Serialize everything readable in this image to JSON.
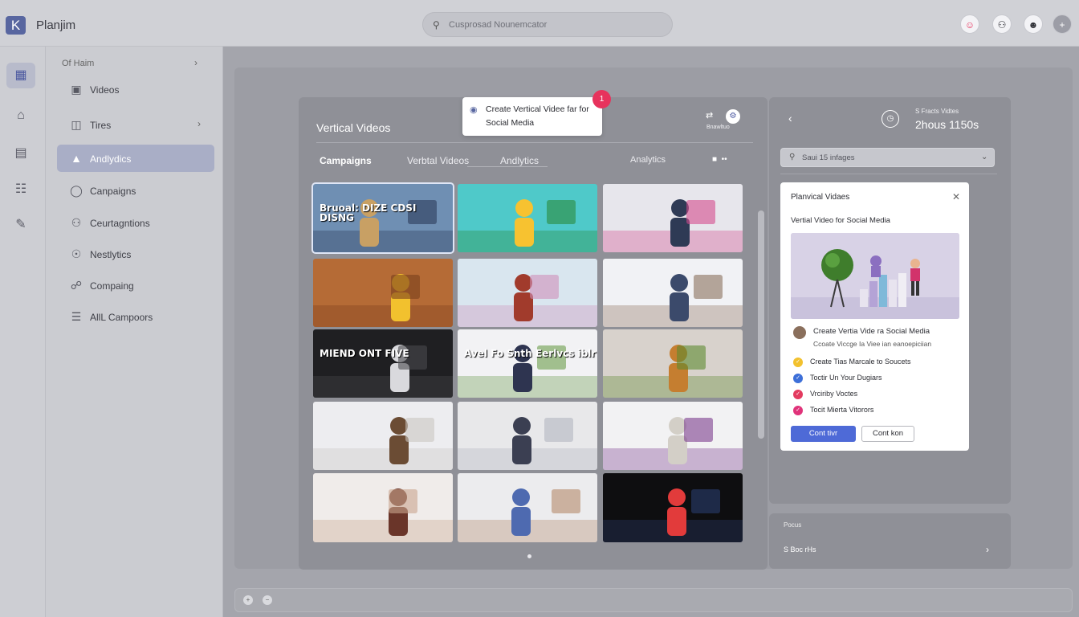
{
  "app": {
    "logo_letter": "K",
    "name": "Planjim"
  },
  "search": {
    "placeholder": "Cusprosad Nounemcator"
  },
  "topbar_icons": [
    "person-alert-icon",
    "person-icon",
    "smiley-icon",
    "plus-icon"
  ],
  "rail_icons": [
    "box-icon",
    "home-icon",
    "document-icon",
    "table-icon",
    "edit-icon"
  ],
  "sidebar": {
    "header": "Of Haim",
    "items": [
      {
        "label": "Videos",
        "icon": "video-icon"
      },
      {
        "label": "Tires",
        "icon": "folder-icon"
      },
      {
        "label": "Andlydics",
        "icon": "analytics-icon",
        "active": true
      },
      {
        "label": "Canpaigns",
        "icon": "chat-icon"
      },
      {
        "label": "Ceurtagntions",
        "icon": "person-icon"
      },
      {
        "label": "Nestlytics",
        "icon": "circle-icon"
      },
      {
        "label": "Compaing",
        "icon": "globe-icon"
      },
      {
        "label": "AllL Campoors",
        "icon": "stack-icon"
      }
    ]
  },
  "videos_panel": {
    "title": "Vertical Videos",
    "header_label": "Bnawltuo",
    "tabs": [
      "Campaigns",
      "Verbtal Videos",
      "Andlytics",
      "Analytics"
    ],
    "tooltip": "Create Vertical Videe far for Social Media",
    "tooltip_badge": "1",
    "thumbnails": [
      {
        "label": "Bruoal: DIZE CDSI DISNG",
        "theme": "beach-tablet"
      },
      {
        "label": "",
        "theme": "smiley-mascot"
      },
      {
        "label": "",
        "theme": "woman-dashboard"
      },
      {
        "label": "",
        "theme": "social-icons-desk"
      },
      {
        "label": "",
        "theme": "two-women-snow"
      },
      {
        "label": "",
        "theme": "woman-laptop-icons"
      },
      {
        "label": "MIEND ONT FIVE",
        "theme": "studio-phone"
      },
      {
        "label": "Avel Fo Snth Eerlvcs iblr",
        "theme": "presenter-board"
      },
      {
        "label": "",
        "theme": "burger"
      },
      {
        "label": "",
        "theme": "man-living-room"
      },
      {
        "label": "",
        "theme": "office-team"
      },
      {
        "label": "",
        "theme": "people-white-room"
      },
      {
        "label": "",
        "theme": "woman-phone-curtains"
      },
      {
        "label": "",
        "theme": "man-sunglasses"
      },
      {
        "label": "",
        "theme": "person-red-play"
      }
    ]
  },
  "detail_panel": {
    "duration_label": "S Fracts Vidtes",
    "duration_value": "2hous 1150s",
    "search_placeholder": "Saui 15 infages",
    "card": {
      "title": "Planvical Vidaes",
      "subtitle": "Vertial Video for Social Media",
      "author": "Create Vertia Vide ra Social Media",
      "author_sub": "Ccoate Viccge Ia Viee ian eanoepiciian",
      "list": [
        {
          "text": "Create Tias Marcale to Soucets",
          "color": "#f2c12e"
        },
        {
          "text": "Toctir Un Your Dugiars",
          "color": "#3d6fd8"
        },
        {
          "text": "Vrciriby Voctes",
          "color": "#e33b5f"
        },
        {
          "text": "Tocit Mierta Vitorors",
          "color": "#e0337a"
        }
      ],
      "primary_button": "Cont tivr",
      "secondary_button": "Cont kon"
    },
    "bottom": {
      "label": "Pocus",
      "value": "S Boc rHs"
    }
  },
  "colors": {
    "accent": "#4e6ad7",
    "active_nav": "#a9aec6",
    "badge": "#e7335d"
  }
}
